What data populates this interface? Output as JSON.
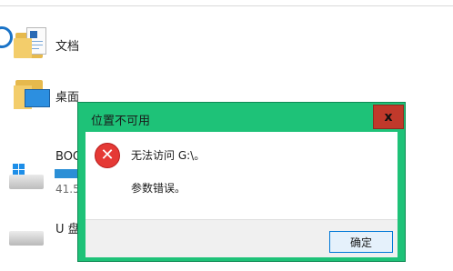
{
  "explorer": {
    "items": [
      {
        "label": "文档",
        "icon": "documents-folder-icon"
      },
      {
        "label": "桌面",
        "icon": "desktop-folder-icon"
      }
    ],
    "drives": [
      {
        "label": "BOO",
        "free_text": "41.5",
        "icon": "windows-drive-icon"
      },
      {
        "label": "U 盘",
        "icon": "usb-drive-icon"
      }
    ]
  },
  "dialog": {
    "title": "位置不可用",
    "close_label": "x",
    "icon": "error-icon",
    "message_line1": "无法访问 G:\\。",
    "message_line2": "参数错误。",
    "ok_label": "确定"
  },
  "colors": {
    "dialog_frame": "#1ec278",
    "close_button": "#c0392b",
    "error_icon": "#e53935",
    "drive_usage": "#2b8fd6"
  }
}
